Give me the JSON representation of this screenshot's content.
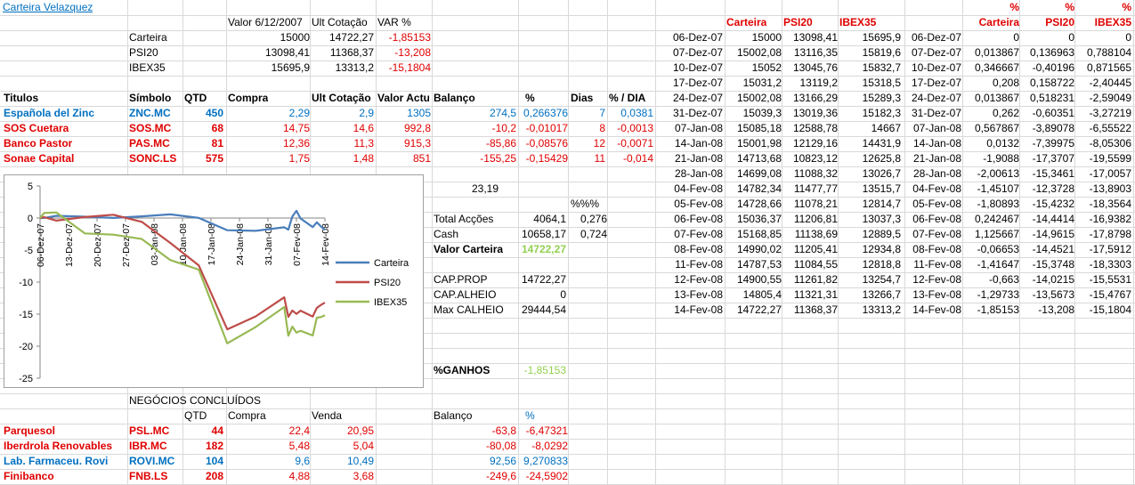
{
  "title": "Carteira Velazquez",
  "summary": {
    "headers": [
      "Valor 6/12/2007",
      "Ult Cotação",
      "VAR %"
    ],
    "rows": [
      {
        "label": "Carteira",
        "valor": "15000",
        "ult": "14722,27",
        "var": "-1,85153"
      },
      {
        "label": "PSI20",
        "valor": "13098,41",
        "ult": "11368,37",
        "var": "-13,208"
      },
      {
        "label": "IBEX35",
        "valor": "15695,9",
        "ult": "13313,2",
        "var": "-15,1804"
      }
    ]
  },
  "holdings": {
    "headers": [
      "Titulos",
      "Símbolo",
      "QTD",
      "Compra",
      "Ult Cotação",
      "Valor Actual",
      "Balanço",
      "%",
      "Dias",
      "% / DIA"
    ],
    "rows": [
      {
        "titulo": "Española del Zinc",
        "simbolo": "ZNC.MC",
        "qtd": "450",
        "compra": "2,29",
        "ult": "2,9",
        "valor": "1305",
        "balanco": "274,5",
        "pct": "0,266376",
        "dias": "7",
        "pctdia": "0,0381",
        "color": "#0070c0"
      },
      {
        "titulo": "SOS Cuetara",
        "simbolo": "SOS.MC",
        "qtd": "68",
        "compra": "14,75",
        "ult": "14,6",
        "valor": "992,8",
        "balanco": "-10,2",
        "pct": "-0,01017",
        "dias": "8",
        "pctdia": "-0,0013",
        "color": "#e00000"
      },
      {
        "titulo": "Banco Pastor",
        "simbolo": "PAS.MC",
        "qtd": "81",
        "compra": "12,36",
        "ult": "11,3",
        "valor": "915,3",
        "balanco": "-85,86",
        "pct": "-0,08576",
        "dias": "12",
        "pctdia": "-0,0071",
        "color": "#e00000"
      },
      {
        "titulo": "Sonae Capital",
        "simbolo": "SONC.LS",
        "qtd": "575",
        "compra": "1,75",
        "ult": "1,48",
        "valor": "851",
        "balanco": "-155,25",
        "pct": "-0,15429",
        "dias": "11",
        "pctdia": "-0,014",
        "color": "#e00000"
      }
    ]
  },
  "stats": {
    "v1": "23,19",
    "pctpct": "%%%",
    "total_accoes_label": "Total Acções",
    "total_accoes": "4064,1",
    "total_accoes_pct": "0,276",
    "cash_label": "Cash",
    "cash": "10658,17",
    "cash_pct": "0,724",
    "valor_carteira_label": "Valor Carteira",
    "valor_carteira": "14722,27",
    "cap_prop_label": "CAP.PROP",
    "cap_prop": "14722,27",
    "cap_alheio_label": "CAP.ALHEIO",
    "cap_alheio": "0",
    "max_calheio_label": "Max CALHEIO",
    "max_calheio": "29444,54",
    "ganhos_label": "%GANHOS",
    "ganhos": "-1,85153"
  },
  "negocios": {
    "title": "NEGÓCIOS CONCLUÍDOS",
    "headers": [
      "QTD",
      "Compra",
      "Venda",
      "Balanço",
      "%"
    ],
    "rows": [
      {
        "titulo": "Parquesol",
        "simbolo": "PSL.MC",
        "qtd": "44",
        "compra": "22,4",
        "venda": "20,95",
        "balanco": "-63,8",
        "pct": "-6,47321",
        "color": "#e00000"
      },
      {
        "titulo": "Iberdrola Renovables",
        "simbolo": "IBR.MC",
        "qtd": "182",
        "compra": "5,48",
        "venda": "5,04",
        "balanco": "-80,08",
        "pct": "-8,0292",
        "color": "#e00000"
      },
      {
        "titulo": "Lab. Farmaceu. Rovi",
        "simbolo": "ROVI.MC",
        "qtd": "104",
        "compra": "9,6",
        "venda": "10,49",
        "balanco": "92,56",
        "pct": "9,270833",
        "color": "#0070c0"
      },
      {
        "titulo": "Finibanco",
        "simbolo": "FNB.LS",
        "qtd": "208",
        "compra": "4,88",
        "venda": "3,68",
        "balanco": "-249,6",
        "pct": "-24,5902",
        "color": "#e00000"
      }
    ]
  },
  "history": {
    "headers": [
      "Carteira",
      "PSI20",
      "IBEX35"
    ],
    "rows": [
      [
        "06-Dez-07",
        "15000",
        "13098,41",
        "15695,9"
      ],
      [
        "07-Dez-07",
        "15002,08",
        "13116,35",
        "15819,6"
      ],
      [
        "10-Dez-07",
        "15052",
        "13045,76",
        "15832,7"
      ],
      [
        "17-Dez-07",
        "15031,2",
        "13119,2",
        "15318,5"
      ],
      [
        "24-Dez-07",
        "15002,08",
        "13166,29",
        "15289,3"
      ],
      [
        "31-Dez-07",
        "15039,3",
        "13019,36",
        "15182,3"
      ],
      [
        "07-Jan-08",
        "15085,18",
        "12588,78",
        "14667"
      ],
      [
        "14-Jan-08",
        "15001,98",
        "12129,16",
        "14431,9"
      ],
      [
        "21-Jan-08",
        "14713,68",
        "10823,12",
        "12625,8"
      ],
      [
        "28-Jan-08",
        "14699,08",
        "11088,32",
        "13026,7"
      ],
      [
        "04-Fev-08",
        "14782,34",
        "11477,77",
        "13515,7"
      ],
      [
        "05-Fev-08",
        "14728,66",
        "11078,21",
        "12814,7"
      ],
      [
        "06-Fev-08",
        "15036,37",
        "11206,81",
        "13037,3"
      ],
      [
        "07-Fev-08",
        "15168,85",
        "11138,69",
        "12889,5"
      ],
      [
        "08-Fev-08",
        "14990,02",
        "11205,41",
        "12934,8"
      ],
      [
        "11-Fev-08",
        "14787,53",
        "11084,55",
        "12818,8"
      ],
      [
        "12-Fev-08",
        "14900,55",
        "11261,82",
        "13254,7"
      ],
      [
        "13-Fev-08",
        "14805,4",
        "11321,31",
        "13266,7"
      ],
      [
        "14-Fev-08",
        "14722,27",
        "11368,37",
        "13313,2"
      ]
    ]
  },
  "variation": {
    "headers": [
      "Carteira",
      "PSI20",
      "IBEX35"
    ],
    "pct": "%",
    "rows": [
      [
        "06-Dez-07",
        "0",
        "0",
        "0"
      ],
      [
        "07-Dez-07",
        "0,013867",
        "0,136963",
        "0,788104"
      ],
      [
        "10-Dez-07",
        "0,346667",
        "-0,40196",
        "0,871565"
      ],
      [
        "17-Dez-07",
        "0,208",
        "0,158722",
        "-2,40445"
      ],
      [
        "24-Dez-07",
        "0,013867",
        "0,518231",
        "-2,59049"
      ],
      [
        "31-Dez-07",
        "0,262",
        "-0,60351",
        "-3,27219"
      ],
      [
        "07-Jan-08",
        "0,567867",
        "-3,89078",
        "-6,55522"
      ],
      [
        "14-Jan-08",
        "0,0132",
        "-7,39975",
        "-8,05306"
      ],
      [
        "21-Jan-08",
        "-1,9088",
        "-17,3707",
        "-19,5599"
      ],
      [
        "28-Jan-08",
        "-2,00613",
        "-15,3461",
        "-17,0057"
      ],
      [
        "04-Fev-08",
        "-1,45107",
        "-12,3728",
        "-13,8903"
      ],
      [
        "05-Fev-08",
        "-1,80893",
        "-15,4232",
        "-18,3564"
      ],
      [
        "06-Fev-08",
        "0,242467",
        "-14,4414",
        "-16,9382"
      ],
      [
        "07-Fev-08",
        "1,125667",
        "-14,9615",
        "-17,8798"
      ],
      [
        "08-Fev-08",
        "-0,06653",
        "-14,4521",
        "-17,5912"
      ],
      [
        "11-Fev-08",
        "-1,41647",
        "-15,3748",
        "-18,3303"
      ],
      [
        "12-Fev-08",
        "-0,663",
        "-14,0215",
        "-15,5531"
      ],
      [
        "13-Fev-08",
        "-1,29733",
        "-13,5673",
        "-15,4767"
      ],
      [
        "14-Fev-08",
        "-1,85153",
        "-13,208",
        "-15,1804"
      ]
    ]
  },
  "chart_data": {
    "type": "line",
    "x": [
      "06-Dez-07",
      "07-Dez-07",
      "10-Dez-07",
      "17-Dez-07",
      "24-Dez-07",
      "31-Dez-07",
      "07-Jan-08",
      "14-Jan-08",
      "21-Jan-08",
      "28-Jan-08",
      "04-Fev-08",
      "05-Fev-08",
      "06-Fev-08",
      "07-Fev-08",
      "08-Fev-08",
      "11-Fev-08",
      "12-Fev-08",
      "13-Fev-08",
      "14-Fev-08"
    ],
    "tick_labels": [
      "06-Dez-07",
      "13-Dez-07",
      "20-Dez-07",
      "27-Dez-07",
      "03-Jan-08",
      "10-Jan-08",
      "17-Jan-08",
      "24-Jan-08",
      "31-Jan-08",
      "07-Fev-08",
      "14-Fev-08"
    ],
    "series": [
      {
        "name": "Carteira",
        "color": "#4a7ebb",
        "values": [
          0,
          0.013867,
          0.346667,
          0.208,
          0.013867,
          0.262,
          0.567867,
          0.0132,
          -1.9088,
          -2.00613,
          -1.45107,
          -1.80893,
          0.242467,
          1.125667,
          -0.06653,
          -1.41647,
          -0.663,
          -1.29733,
          -1.85153
        ]
      },
      {
        "name": "PSI20",
        "color": "#be4b48",
        "values": [
          0,
          0.136963,
          -0.40196,
          0.158722,
          0.518231,
          -0.60351,
          -3.89078,
          -7.39975,
          -17.3707,
          -15.3461,
          -12.3728,
          -15.4232,
          -14.4414,
          -14.9615,
          -14.4521,
          -15.3748,
          -14.0215,
          -13.5673,
          -13.208
        ]
      },
      {
        "name": "IBEX35",
        "color": "#98b954",
        "values": [
          0,
          0.788104,
          0.871565,
          -2.40445,
          -2.59049,
          -3.27219,
          -6.55522,
          -8.05306,
          -19.5599,
          -17.0057,
          -13.8903,
          -18.3564,
          -16.9382,
          -17.8798,
          -17.5912,
          -18.3303,
          -15.5531,
          -15.4767,
          -15.1804
        ]
      }
    ],
    "yticks": [
      "5",
      "0",
      "-5",
      "-10",
      "-15",
      "-20",
      "-25"
    ],
    "ylim": [
      -25,
      5
    ],
    "legend": "right",
    "grid": false
  }
}
